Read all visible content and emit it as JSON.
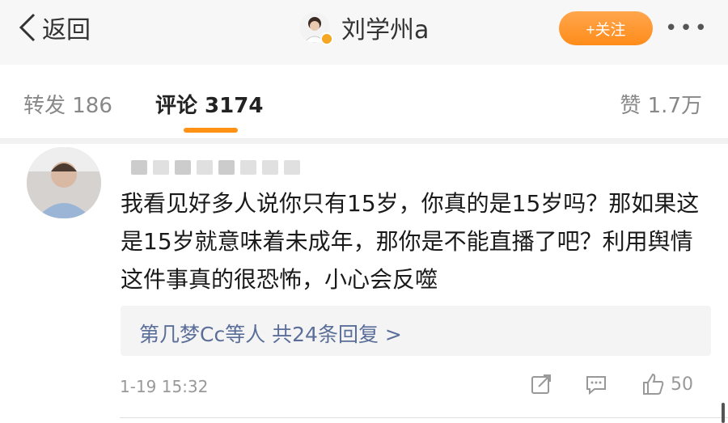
{
  "header": {
    "back_label": "返回",
    "author_name": "刘学州a",
    "follow_label": "+关注",
    "more_label": "•••"
  },
  "tabs": {
    "forward": "转发 186",
    "comment": "评论 3174",
    "like": "赞 1.7万"
  },
  "comment": {
    "text": "我看见好多人说你只有15岁，你真的是15岁吗？那如果这是15岁就意味着未成年，那你是不能直播了吧？利用舆情这件事真的很恐怖，小心会反噬",
    "replies_summary": "第几梦Cc等人 共24条回复 >",
    "time": "1-19 15:32",
    "like_count": "50"
  },
  "colors": {
    "accent": "#ff9214",
    "follow_button": "#ff8c1a",
    "link": "#5a6e99",
    "header_bg": "#f7f7f7"
  },
  "icons": [
    "back-chevron-icon",
    "verified-badge-icon",
    "share-icon",
    "reply-icon",
    "like-icon"
  ]
}
